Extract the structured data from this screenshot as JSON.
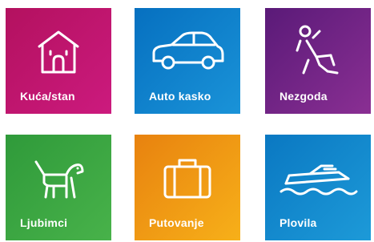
{
  "tiles": [
    {
      "label": "Kuća/stan",
      "icon": "house-icon",
      "color": "#c2176f"
    },
    {
      "label": "Auto kasko",
      "icon": "car-icon",
      "color": "#0a82cc"
    },
    {
      "label": "Nezgoda",
      "icon": "falling-person-icon",
      "color": "#6e2386"
    },
    {
      "label": "Ljubimci",
      "icon": "dog-icon",
      "color": "#3aa542"
    },
    {
      "label": "Putovanje",
      "icon": "suitcase-icon",
      "color": "#f09a14"
    },
    {
      "label": "Plovila",
      "icon": "boat-icon",
      "color": "#1289cf"
    }
  ]
}
